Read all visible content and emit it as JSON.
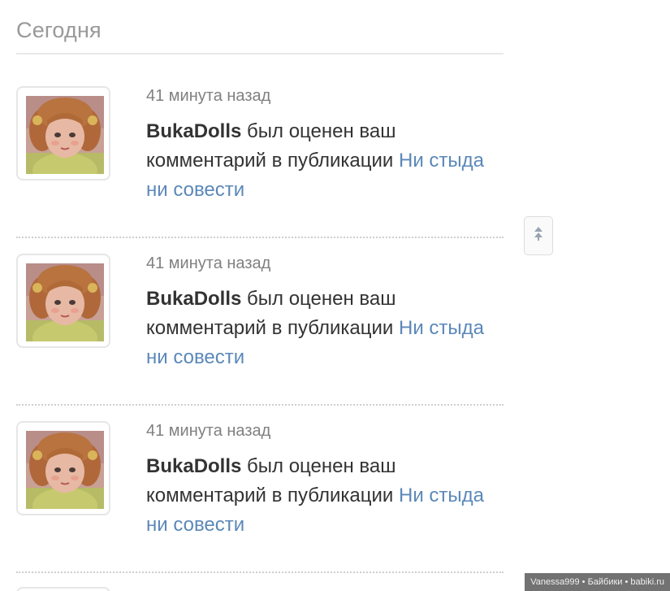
{
  "section": {
    "title": "Сегодня"
  },
  "notifications": [
    {
      "time": "41 минута назад",
      "user": "BukaDolls",
      "text": " был оценен ваш комментарий в публикации ",
      "link": "Ни стыда ни совести",
      "avatar_icon": "doll-avatar"
    },
    {
      "time": "41 минута назад",
      "user": "BukaDolls",
      "text": " был оценен ваш комментарий в публикации ",
      "link": "Ни стыда ни совести",
      "avatar_icon": "doll-avatar"
    },
    {
      "time": "41 минута назад",
      "user": "BukaDolls",
      "text": " был оценен ваш комментарий в публикации ",
      "link": "Ни стыда ни совести",
      "avatar_icon": "doll-avatar"
    }
  ],
  "scroll_top": {
    "icon": "double-arrow-up-icon"
  },
  "watermark": {
    "text": "Vanessa999 • Байбики • babiki.ru"
  },
  "colors": {
    "link": "#5b88b8",
    "muted_text": "#808080",
    "title_text": "#999999",
    "body_text": "#333333"
  }
}
